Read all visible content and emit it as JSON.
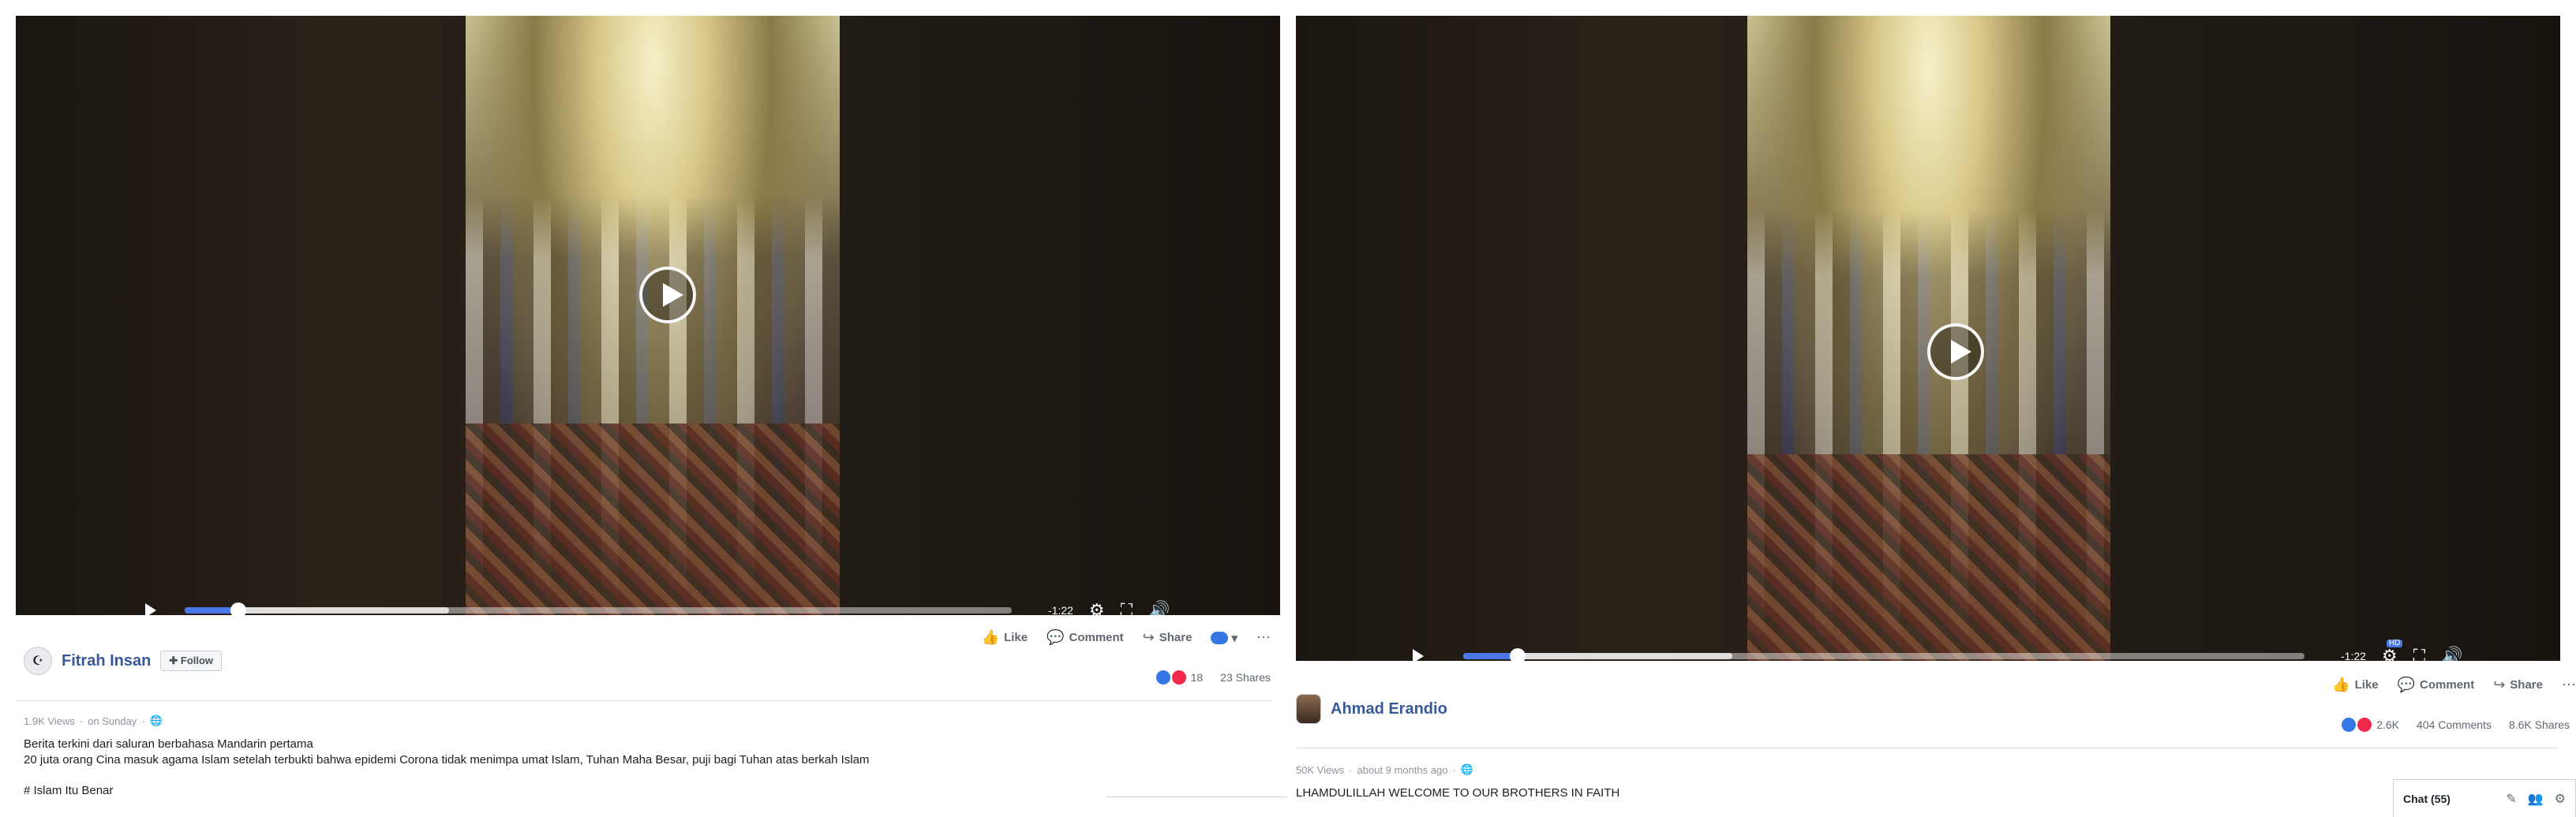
{
  "left_post": {
    "video": {
      "time_remaining": "-1:22",
      "progress_fraction": 0.06,
      "buffered_fraction": 0.32
    },
    "author": {
      "name": "Fitrah Insan",
      "follow_label": "Follow"
    },
    "actions": {
      "like": "Like",
      "comment": "Comment",
      "share": "Share"
    },
    "stats": {
      "reactions": "18",
      "shares": "23 Shares"
    },
    "meta": {
      "views": "1.9K Views",
      "separator": "·",
      "date": "on Sunday"
    },
    "caption_lines": [
      "Berita terkini dari saluran berbahasa Mandarin pertama",
      "20 juta orang Cina masuk agama Islam setelah terbukti bahwa epidemi Corona tidak menimpa umat Islam, Tuhan Maha Besar, puji bagi Tuhan atas berkah Islam"
    ],
    "hashtag": "# Islam Itu Benar"
  },
  "right_post": {
    "video": {
      "time_remaining": "-1:22",
      "hd_label": "HD",
      "progress_fraction": 0.06,
      "buffered_fraction": 0.32
    },
    "author": {
      "name": "Ahmad Erandio"
    },
    "actions": {
      "like": "Like",
      "comment": "Comment",
      "share": "Share"
    },
    "stats": {
      "reactions": "2.6K",
      "comments": "404 Comments",
      "shares": "8.6K Shares"
    },
    "meta": {
      "views": "50K Views",
      "separator": "·",
      "date": "about 9 months ago"
    },
    "caption": "LHAMDULILLAH WELCOME TO OUR BROTHERS IN FAITH",
    "chat": {
      "label": "Chat (55)"
    }
  },
  "icons": {
    "play": "play-icon",
    "settings": "gear-icon",
    "fullscreen": "fullscreen-icon",
    "volume": "volume-icon",
    "like": "thumbs-up-icon",
    "comment": "comment-icon",
    "share": "share-icon",
    "more": "more-icon",
    "globe": "globe-icon"
  },
  "colors": {
    "link": "#385898",
    "progress": "#4a76e8",
    "like": "#3578e5",
    "love": "#f0284a"
  }
}
